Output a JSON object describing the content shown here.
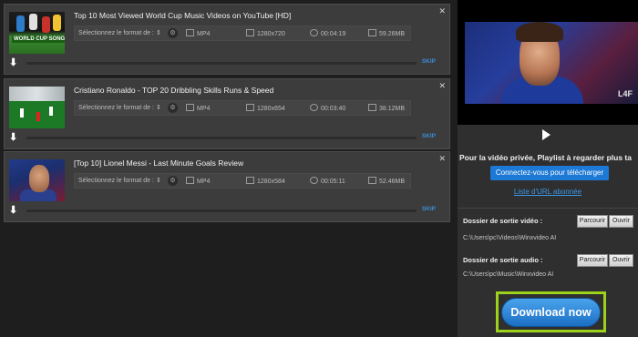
{
  "downloads": [
    {
      "title": "Top 10 Most Viewed World Cup Music Videos on YouTube [HD]",
      "thumb_label": "WORLD CUP SONGS",
      "format_select": "Sélectionnez le format de :",
      "format": "MP4",
      "resolution": "1280x720",
      "duration": "00:04:19",
      "size": "59.26MB",
      "skip": "SKIP",
      "progress": 0
    },
    {
      "title": "Cristiano Ronaldo - TOP 20 Dribbling Skills Runs & Speed",
      "format_select": "Sélectionnez le format de :",
      "format": "MP4",
      "resolution": "1280x654",
      "duration": "00:03:40",
      "size": "38.12MB",
      "skip": "SKIP",
      "progress": 0
    },
    {
      "title": "[Top 10] Lionel Messi - Last Minute Goals Review",
      "format_select": "Sélectionnez le format de :",
      "format": "MP4",
      "resolution": "1280x584",
      "duration": "00:05:11",
      "size": "52.46MB",
      "skip": "SKIP",
      "progress": 0
    }
  ],
  "preview": {
    "logo": "L4F"
  },
  "private": {
    "text": "Pour la vidéo privée, Playlist à regarder plus ta",
    "connect_button": "Connectez-vous pour télécharger",
    "url_link": "Liste d'URL abonnée"
  },
  "output": {
    "video_label": "Dossier de sortie vidéo :",
    "video_path": "C:\\Users\\pc\\Videos\\Winxvideo AI",
    "audio_label": "Dossier de sortie audio :",
    "audio_path": "C:\\Users\\pc\\Music\\Winxvideo AI",
    "browse_button": "Parcourir",
    "open_button": "Ouvrir"
  },
  "download_button": "Download now",
  "colors": {
    "accent_blue": "#1d79d6",
    "highlight_green": "#9dd21b",
    "link_blue": "#3d96e6"
  }
}
